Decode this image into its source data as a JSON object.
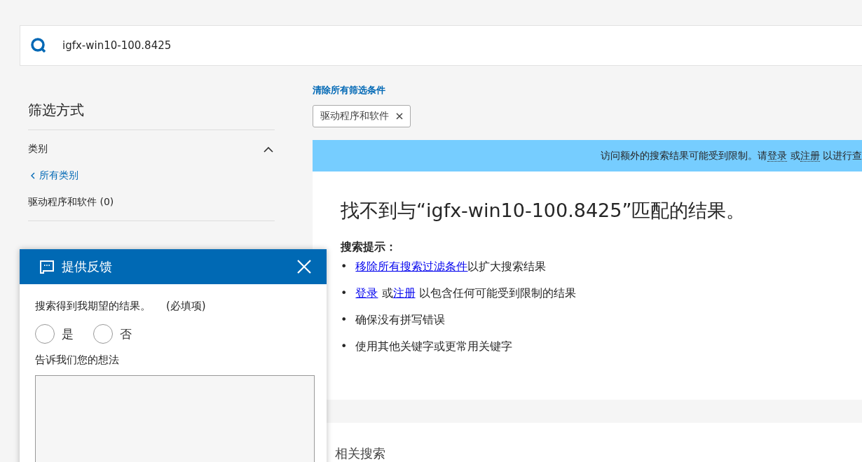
{
  "search": {
    "value": "igfx-win10-100.8425"
  },
  "sidebar": {
    "title": "筛选方式",
    "section": {
      "title": "类别",
      "expanded": true
    },
    "back_link": "所有类别",
    "items": [
      {
        "label": "驱动程序和软件 (0)"
      }
    ]
  },
  "clear_filters": "清除所有筛选条件",
  "active_filters": [
    {
      "label": "驱动程序和软件"
    }
  ],
  "banner": {
    "parts": [
      {
        "text": "访问额外的搜索结果可能受到限制。请",
        "kind": "text"
      },
      {
        "text": "登录",
        "kind": "link"
      },
      {
        "text": " 或",
        "kind": "text"
      },
      {
        "text": "注册",
        "kind": "link"
      },
      {
        "text": " 以进行查",
        "kind": "text"
      }
    ]
  },
  "results": {
    "title": "找不到与“igfx-win10-100.8425”匹配的结果。",
    "tips_heading": "搜索提示：",
    "tips": [
      {
        "bullet": "•",
        "parts": [
          {
            "text": "移除所有搜索过滤条件",
            "kind": "link"
          },
          {
            "text": "以扩大搜索结果",
            "kind": "text"
          }
        ]
      },
      {
        "bullet": "•",
        "parts": [
          {
            "text": "登录",
            "kind": "link"
          },
          {
            "text": " 或",
            "kind": "text"
          },
          {
            "text": "注册",
            "kind": "link"
          },
          {
            "text": " 以包含任何可能受到限制的结果",
            "kind": "text"
          }
        ]
      },
      {
        "bullet": "•",
        "parts": [
          {
            "text": "确保没有拼写错误",
            "kind": "text"
          }
        ]
      },
      {
        "bullet": "•",
        "parts": [
          {
            "text": "使用其他关键字或更常用关键字",
            "kind": "text"
          }
        ]
      }
    ]
  },
  "related": {
    "title": "相关搜索"
  },
  "feedback": {
    "title": "提供反馈",
    "question": "搜索得到我期望的结果。",
    "required_note": "(必填项)",
    "options": [
      {
        "label": "是",
        "selected": false
      },
      {
        "label": "否",
        "selected": false
      }
    ],
    "comment_label": "告诉我们您的想法"
  }
}
